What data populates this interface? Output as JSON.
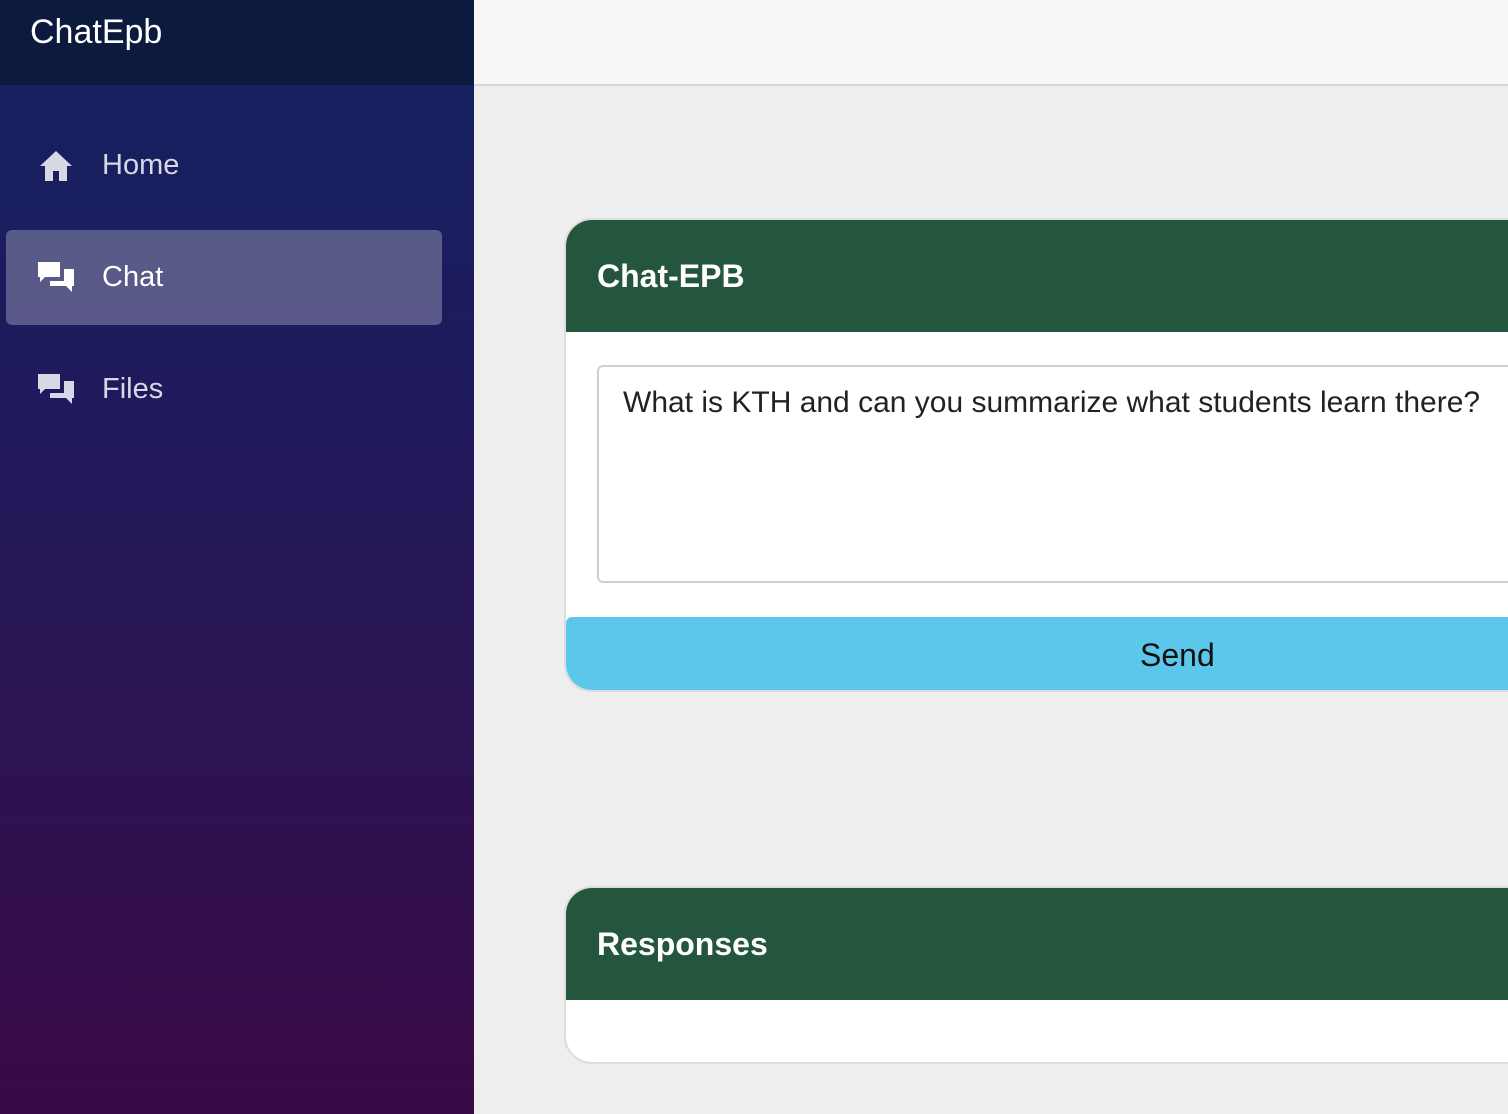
{
  "app": {
    "brand": "ChatEpb"
  },
  "sidebar": {
    "items": [
      {
        "label": "Home",
        "icon": "home-icon",
        "active": false
      },
      {
        "label": "Chat",
        "icon": "chat-icon",
        "active": true
      },
      {
        "label": "Files",
        "icon": "chat-icon",
        "active": false
      }
    ]
  },
  "chat_card": {
    "title": "Chat-EPB",
    "prompt_value": "What is KTH and can you summarize what students learn there?",
    "send_label": "Send"
  },
  "responses_card": {
    "title": "Responses"
  },
  "colors": {
    "sidebar_top": "#132260",
    "sidebar_bottom": "#3a0a46",
    "brand_bar": "#0b1a3d",
    "card_header": "#24553d",
    "send_button": "#5bc7ea",
    "background": "#eeeeee"
  }
}
